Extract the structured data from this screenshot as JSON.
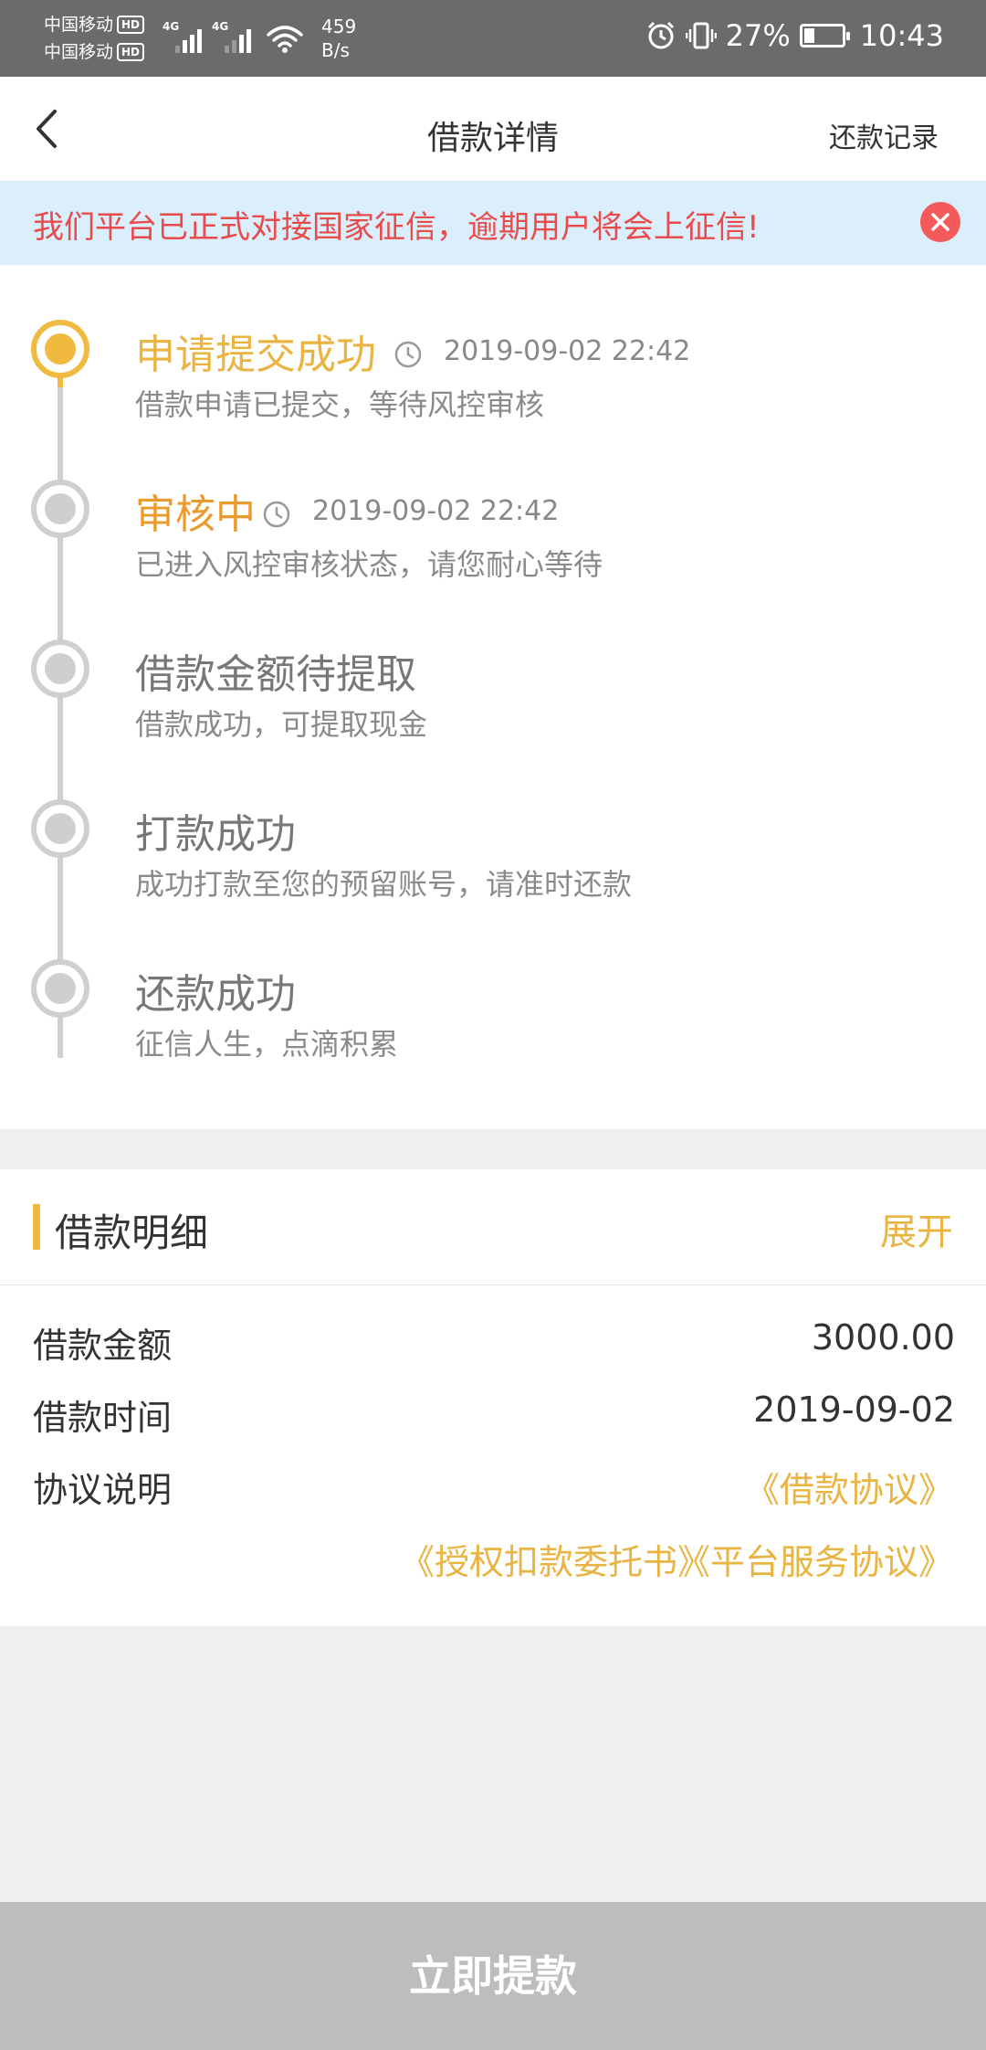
{
  "status_bar": {
    "carrier1": "中国移动",
    "carrier2": "中国移动",
    "hd": "HD",
    "network1": "4G",
    "network2": "4G",
    "net_speed_value": "459",
    "net_speed_unit": "B/s",
    "battery_percent": "27%",
    "battery_level": 0.27,
    "time": "10:43",
    "icons": [
      "alarm-icon",
      "vibrate-icon",
      "wifi-icon",
      "battery-icon"
    ]
  },
  "header": {
    "back_icon": "chevron-left-icon",
    "title": "借款详情",
    "right_action": "还款记录"
  },
  "notice": {
    "text": "我们平台已正式对接国家征信，逾期用户将会上征信!",
    "close_icon": "close-icon"
  },
  "timeline": {
    "steps": [
      {
        "title": "申请提交成功",
        "time": "2019-09-02 22:42",
        "desc": "借款申请已提交，等待风控审核",
        "status": "done"
      },
      {
        "title": "审核中",
        "time": "2019-09-02 22:42",
        "desc": "已进入风控审核状态，请您耐心等待",
        "status": "current"
      },
      {
        "title": "借款金额待提取",
        "desc": "借款成功，可提取现金",
        "status": "pending"
      },
      {
        "title": "打款成功",
        "desc": "成功打款至您的预留账号，请准时还款",
        "status": "pending"
      },
      {
        "title": "还款成功",
        "desc": "征信人生，点滴积累",
        "status": "pending"
      }
    ]
  },
  "detail": {
    "title": "借款明细",
    "expand_label": "展开",
    "amount_label": "借款金额",
    "amount_value": "3000.00",
    "time_label": "借款时间",
    "time_value": "2019-09-02",
    "agreement_label": "协议说明",
    "agreements": [
      "《借款协议》",
      "《授权扣款委托书》",
      "《平台服务协议》"
    ]
  },
  "bottom": {
    "button_label": "立即提款"
  },
  "colors": {
    "accent": "#f0b940",
    "accent_text": "#eab443",
    "in_progress": "#ec9a2c",
    "notice_text": "#e94b4b",
    "notice_bg": "#dbeefc",
    "button_bg": "#bdbdbd"
  }
}
